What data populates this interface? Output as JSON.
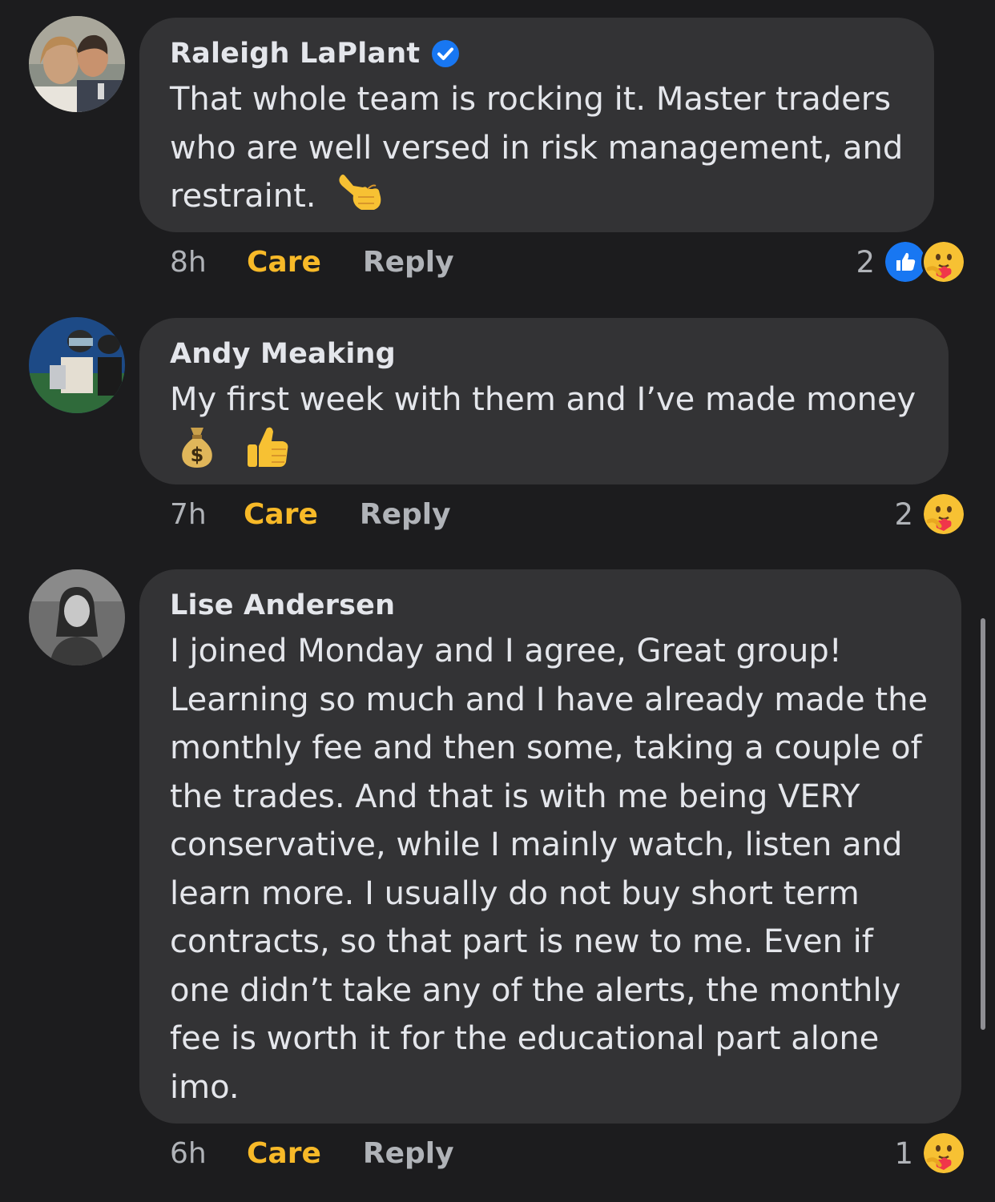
{
  "comments": [
    {
      "author": "Raleigh LaPlant",
      "verified": true,
      "lines": [
        "That whole team is rocking it. Master traders",
        "who are well versed in risk management, and",
        "restraint."
      ],
      "trailing_emoji": "call-me-hand",
      "time": "8h",
      "reaction_label": "Care",
      "reply_label": "Reply",
      "reaction_count": "2",
      "reaction_icons": [
        "like-icon",
        "care-icon"
      ]
    },
    {
      "author": "Andy Meaking",
      "verified": false,
      "lines": [
        "My first week with them and I’ve made money"
      ],
      "emoji_line": [
        "money-bag",
        "thumbs-up"
      ],
      "time": "7h",
      "reaction_label": "Care",
      "reply_label": "Reply",
      "reaction_count": "2",
      "reaction_icons": [
        "care-icon"
      ]
    },
    {
      "author": "Lise Andersen",
      "verified": false,
      "lines": [
        "I joined Monday and I agree, Great group!",
        "Learning so much and I have already made the",
        "monthly fee and then some, taking a couple of",
        "the trades. And that is with me being VERY",
        "conservative, while I mainly watch, listen and",
        "learn more. I usually do not buy short term",
        "contracts, so that part is new to me. Even if",
        "one didn’t take any of the alerts, the monthly",
        "fee is worth it for the educational part alone",
        "imo."
      ],
      "time": "6h",
      "reaction_label": "Care",
      "reply_label": "Reply",
      "reaction_count": "1",
      "reaction_icons": [
        "care-icon"
      ]
    }
  ],
  "colors": {
    "background": "#1c1c1e",
    "bubble": "#333335",
    "care_accent": "#f7b928",
    "muted": "#b0b3b8",
    "verified_blue": "#1877f2"
  }
}
